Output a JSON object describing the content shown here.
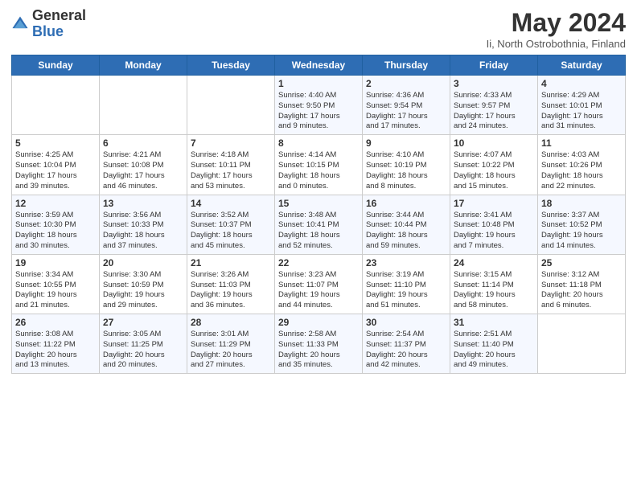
{
  "logo": {
    "general": "General",
    "blue": "Blue"
  },
  "title": "May 2024",
  "location": "Ii, North Ostrobothnia, Finland",
  "weekdays": [
    "Sunday",
    "Monday",
    "Tuesday",
    "Wednesday",
    "Thursday",
    "Friday",
    "Saturday"
  ],
  "weeks": [
    [
      {
        "day": "",
        "info": ""
      },
      {
        "day": "",
        "info": ""
      },
      {
        "day": "",
        "info": ""
      },
      {
        "day": "1",
        "info": "Sunrise: 4:40 AM\nSunset: 9:50 PM\nDaylight: 17 hours\nand 9 minutes."
      },
      {
        "day": "2",
        "info": "Sunrise: 4:36 AM\nSunset: 9:54 PM\nDaylight: 17 hours\nand 17 minutes."
      },
      {
        "day": "3",
        "info": "Sunrise: 4:33 AM\nSunset: 9:57 PM\nDaylight: 17 hours\nand 24 minutes."
      },
      {
        "day": "4",
        "info": "Sunrise: 4:29 AM\nSunset: 10:01 PM\nDaylight: 17 hours\nand 31 minutes."
      }
    ],
    [
      {
        "day": "5",
        "info": "Sunrise: 4:25 AM\nSunset: 10:04 PM\nDaylight: 17 hours\nand 39 minutes."
      },
      {
        "day": "6",
        "info": "Sunrise: 4:21 AM\nSunset: 10:08 PM\nDaylight: 17 hours\nand 46 minutes."
      },
      {
        "day": "7",
        "info": "Sunrise: 4:18 AM\nSunset: 10:11 PM\nDaylight: 17 hours\nand 53 minutes."
      },
      {
        "day": "8",
        "info": "Sunrise: 4:14 AM\nSunset: 10:15 PM\nDaylight: 18 hours\nand 0 minutes."
      },
      {
        "day": "9",
        "info": "Sunrise: 4:10 AM\nSunset: 10:19 PM\nDaylight: 18 hours\nand 8 minutes."
      },
      {
        "day": "10",
        "info": "Sunrise: 4:07 AM\nSunset: 10:22 PM\nDaylight: 18 hours\nand 15 minutes."
      },
      {
        "day": "11",
        "info": "Sunrise: 4:03 AM\nSunset: 10:26 PM\nDaylight: 18 hours\nand 22 minutes."
      }
    ],
    [
      {
        "day": "12",
        "info": "Sunrise: 3:59 AM\nSunset: 10:30 PM\nDaylight: 18 hours\nand 30 minutes."
      },
      {
        "day": "13",
        "info": "Sunrise: 3:56 AM\nSunset: 10:33 PM\nDaylight: 18 hours\nand 37 minutes."
      },
      {
        "day": "14",
        "info": "Sunrise: 3:52 AM\nSunset: 10:37 PM\nDaylight: 18 hours\nand 45 minutes."
      },
      {
        "day": "15",
        "info": "Sunrise: 3:48 AM\nSunset: 10:41 PM\nDaylight: 18 hours\nand 52 minutes."
      },
      {
        "day": "16",
        "info": "Sunrise: 3:44 AM\nSunset: 10:44 PM\nDaylight: 18 hours\nand 59 minutes."
      },
      {
        "day": "17",
        "info": "Sunrise: 3:41 AM\nSunset: 10:48 PM\nDaylight: 19 hours\nand 7 minutes."
      },
      {
        "day": "18",
        "info": "Sunrise: 3:37 AM\nSunset: 10:52 PM\nDaylight: 19 hours\nand 14 minutes."
      }
    ],
    [
      {
        "day": "19",
        "info": "Sunrise: 3:34 AM\nSunset: 10:55 PM\nDaylight: 19 hours\nand 21 minutes."
      },
      {
        "day": "20",
        "info": "Sunrise: 3:30 AM\nSunset: 10:59 PM\nDaylight: 19 hours\nand 29 minutes."
      },
      {
        "day": "21",
        "info": "Sunrise: 3:26 AM\nSunset: 11:03 PM\nDaylight: 19 hours\nand 36 minutes."
      },
      {
        "day": "22",
        "info": "Sunrise: 3:23 AM\nSunset: 11:07 PM\nDaylight: 19 hours\nand 44 minutes."
      },
      {
        "day": "23",
        "info": "Sunrise: 3:19 AM\nSunset: 11:10 PM\nDaylight: 19 hours\nand 51 minutes."
      },
      {
        "day": "24",
        "info": "Sunrise: 3:15 AM\nSunset: 11:14 PM\nDaylight: 19 hours\nand 58 minutes."
      },
      {
        "day": "25",
        "info": "Sunrise: 3:12 AM\nSunset: 11:18 PM\nDaylight: 20 hours\nand 6 minutes."
      }
    ],
    [
      {
        "day": "26",
        "info": "Sunrise: 3:08 AM\nSunset: 11:22 PM\nDaylight: 20 hours\nand 13 minutes."
      },
      {
        "day": "27",
        "info": "Sunrise: 3:05 AM\nSunset: 11:25 PM\nDaylight: 20 hours\nand 20 minutes."
      },
      {
        "day": "28",
        "info": "Sunrise: 3:01 AM\nSunset: 11:29 PM\nDaylight: 20 hours\nand 27 minutes."
      },
      {
        "day": "29",
        "info": "Sunrise: 2:58 AM\nSunset: 11:33 PM\nDaylight: 20 hours\nand 35 minutes."
      },
      {
        "day": "30",
        "info": "Sunrise: 2:54 AM\nSunset: 11:37 PM\nDaylight: 20 hours\nand 42 minutes."
      },
      {
        "day": "31",
        "info": "Sunrise: 2:51 AM\nSunset: 11:40 PM\nDaylight: 20 hours\nand 49 minutes."
      },
      {
        "day": "",
        "info": ""
      }
    ]
  ]
}
